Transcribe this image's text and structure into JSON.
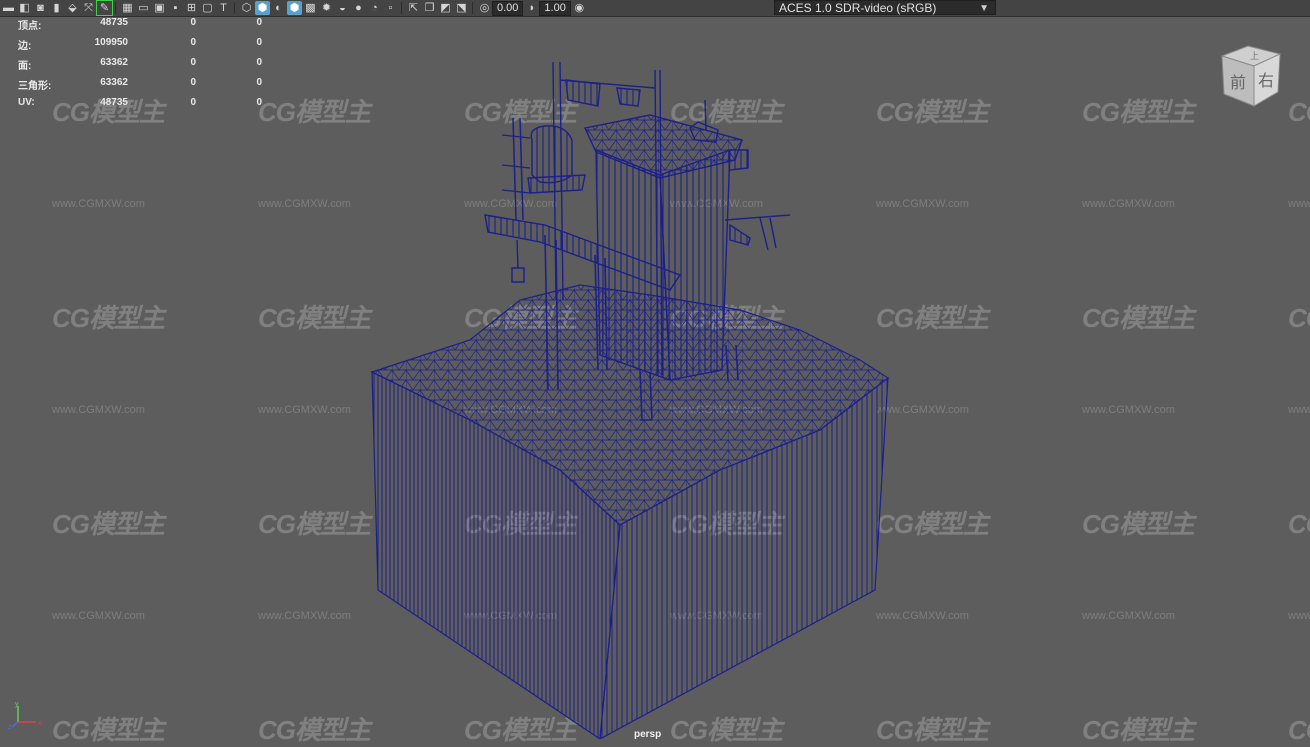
{
  "toolbar": {
    "exposure_value": "0.00",
    "gamma_value": "1.00",
    "colorspace_label": "ACES 1.0 SDR-video (sRGB)",
    "icons": [
      "camera-icon",
      "camera-attr-icon",
      "bookmark-icon",
      "image-plane-icon",
      "grid-icon",
      "film-gate-icon",
      "resolution-gate-icon",
      "wireframe-icon",
      "smooth-shade-icon",
      "textured-icon",
      "lighting-icon",
      "shadows-icon",
      "ambient-occlusion-icon",
      "isolate-icon",
      "xray-icon",
      "exposure-icon",
      "gamma-icon"
    ]
  },
  "hud": {
    "rows": [
      {
        "label": "顶点:",
        "v1": "48735",
        "v2": "0",
        "v3": "0"
      },
      {
        "label": "边:",
        "v1": "109950",
        "v2": "0",
        "v3": "0"
      },
      {
        "label": "面:",
        "v1": "63362",
        "v2": "0",
        "v3": "0"
      },
      {
        "label": "三角形:",
        "v1": "63362",
        "v2": "0",
        "v3": "0"
      },
      {
        "label": "UV:",
        "v1": "48735",
        "v2": "0",
        "v3": "0"
      }
    ]
  },
  "viewcube": {
    "top_label": "上",
    "front_label": "前",
    "right_label": "右"
  },
  "camera_label": "persp",
  "axis": {
    "x": "x",
    "y": "y",
    "z": "z"
  },
  "watermark": {
    "logo": "CG模型主",
    "url": "www.CGMXW.com"
  },
  "colors": {
    "viewport_bg": "#5d5d5d",
    "wire": "#1d1f8a",
    "toolbar_bg": "#444444",
    "active_button": "#5aa1c9"
  }
}
